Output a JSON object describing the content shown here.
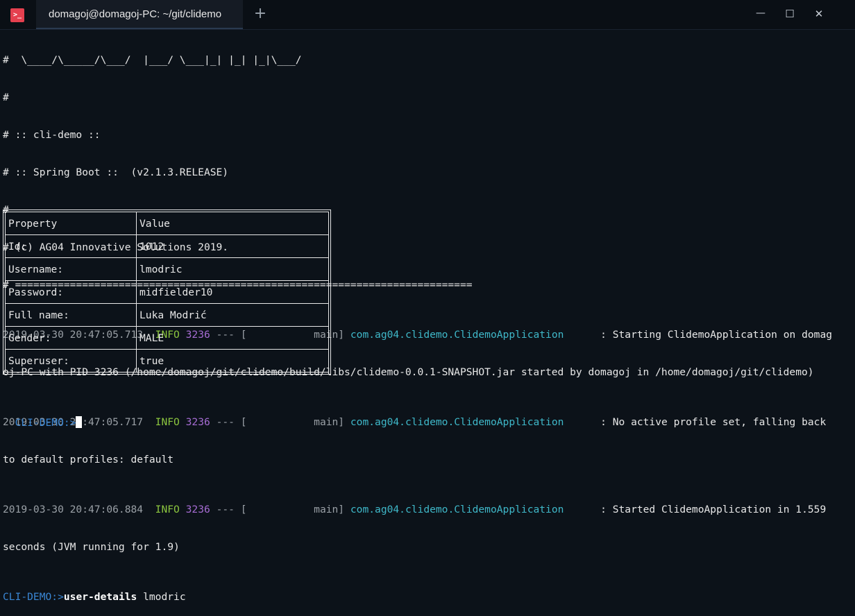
{
  "window": {
    "tab_title": "domagoj@domagoj-PC: ~/git/clidemo",
    "new_tab_glyph": "+",
    "minimize_glyph": "—",
    "maximize_glyph": "☐",
    "close_glyph": "✕",
    "app_icon_glyph": ">_"
  },
  "banner": [
    "#  \\____/\\_____/\\___/  |___/ \\___|_| |_| |_|\\___/",
    "#",
    "# :: cli-demo ::",
    "# :: Spring Boot ::  (v2.1.3.RELEASE)",
    "#",
    "# (c) AG04 Innovative Solutions 2019.",
    "# ==========================================================================="
  ],
  "logs": [
    {
      "timestamp": "2019-03-30 20:47:05.713",
      "level": "INFO",
      "pid": "3236",
      "sep": "--- [           main]",
      "logger": "com.ag04.clidemo.ClidemoApplication",
      "message": "      : Starting ClidemoApplication on domag",
      "continuation": "oj-PC with PID 3236 (/home/domagoj/git/clidemo/build/libs/clidemo-0.0.1-SNAPSHOT.jar started by domagoj in /home/domagoj/git/clidemo)"
    },
    {
      "timestamp": "2019-03-30 20:47:05.717",
      "level": "INFO",
      "pid": "3236",
      "sep": "--- [           main]",
      "logger": "com.ag04.clidemo.ClidemoApplication",
      "message": "      : No active profile set, falling back",
      "continuation": "to default profiles: default"
    },
    {
      "timestamp": "2019-03-30 20:47:06.884",
      "level": "INFO",
      "pid": "3236",
      "sep": "--- [           main]",
      "logger": "com.ag04.clidemo.ClidemoApplication",
      "message": "      : Started ClidemoApplication in 1.559",
      "continuation": "seconds (JVM running for 1.9)"
    }
  ],
  "command": {
    "prompt": "CLI-DEMO:>",
    "name": "user-details",
    "args": " lmodric"
  },
  "table": {
    "header": [
      "Property",
      "Value"
    ],
    "rows": [
      [
        "Id:",
        "1012"
      ],
      [
        "Username:",
        "lmodric"
      ],
      [
        "Password:",
        "midfielder10"
      ],
      [
        "Full name:",
        "Luka Modrić"
      ],
      [
        "Gender:",
        "MALE"
      ],
      [
        "Superuser:",
        "true"
      ]
    ]
  },
  "final_prompt": "CLI-DEMO:>",
  "colors": {
    "background": "#0c1219",
    "info": "#8cc63f",
    "pid": "#a66cd3",
    "logger": "#3fb8c9",
    "prompt": "#3a86d4",
    "app_icon": "#e5404f"
  }
}
